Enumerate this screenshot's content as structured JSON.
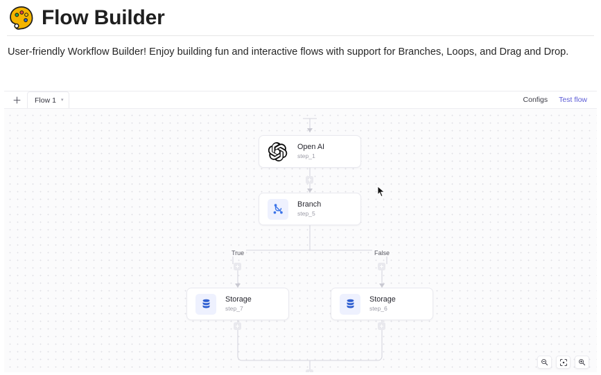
{
  "header": {
    "title": "Flow Builder",
    "icon": "artist-palette-emoji"
  },
  "description": {
    "text": "User-friendly Workflow Builder! Enjoy building fun and interactive flows with support for Branches, Loops, and Drag and Drop."
  },
  "toolbar": {
    "add_tab_label": "+",
    "tabs": [
      {
        "label": "Flow 1",
        "caret": "▾",
        "active": true
      }
    ],
    "actions": [
      {
        "label": "Configs",
        "accent": false
      },
      {
        "label": "Test flow",
        "accent": true
      }
    ]
  },
  "canvas": {
    "nodes": [
      {
        "id": "step_1",
        "title": "Open AI",
        "subtitle": "step_1",
        "icon": "openai-logo-icon"
      },
      {
        "id": "step_5",
        "title": "Branch",
        "subtitle": "step_5",
        "icon": "branch-icon"
      },
      {
        "id": "step_7",
        "title": "Storage",
        "subtitle": "step_7",
        "icon": "database-icon"
      },
      {
        "id": "step_6",
        "title": "Storage",
        "subtitle": "step_6",
        "icon": "database-icon"
      }
    ],
    "branch_labels": [
      {
        "label": "True"
      },
      {
        "label": "False"
      }
    ],
    "add_step_label": "+"
  },
  "zoom_controls": [
    {
      "name": "zoom-out",
      "icon": "magnifier-minus-icon"
    },
    {
      "name": "fit-view",
      "icon": "fit-screen-icon"
    },
    {
      "name": "zoom-in",
      "icon": "magnifier-plus-icon"
    }
  ],
  "colors": {
    "accent": "#5b5bd6",
    "node_icon_tint": "#eef1fe",
    "branch_blue": "#3b74e8",
    "canvas_bg": "#fbfbfc",
    "edge_line": "#d6d6de"
  }
}
